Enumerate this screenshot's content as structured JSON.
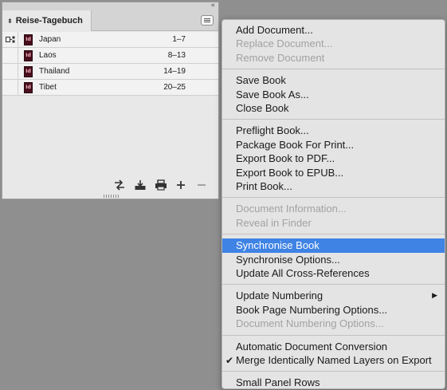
{
  "panel": {
    "title": "Reise-Tagebuch",
    "tab_arrows": "⬍",
    "collapse_glyph": "«",
    "documents": [
      {
        "name": "Japan",
        "pages": "1–7",
        "status": "synced-source"
      },
      {
        "name": "Laos",
        "pages": "8–13"
      },
      {
        "name": "Thailand",
        "pages": "14–19"
      },
      {
        "name": "Tibet",
        "pages": "20–25"
      }
    ],
    "doc_icon_text": "Id",
    "toolbar": [
      "sync-styles-icon",
      "save-book-icon",
      "print-book-icon",
      "add-document-icon",
      "remove-document-icon"
    ]
  },
  "menu": {
    "highlight_color": "#3f83e5",
    "groups": [
      [
        {
          "label": "Add Document...",
          "enabled": true
        },
        {
          "label": "Replace Document...",
          "enabled": false
        },
        {
          "label": "Remove Document",
          "enabled": false
        }
      ],
      [
        {
          "label": "Save Book",
          "enabled": true
        },
        {
          "label": "Save Book As...",
          "enabled": true
        },
        {
          "label": "Close Book",
          "enabled": true
        }
      ],
      [
        {
          "label": "Preflight Book...",
          "enabled": true
        },
        {
          "label": "Package Book For Print...",
          "enabled": true
        },
        {
          "label": "Export Book to PDF...",
          "enabled": true
        },
        {
          "label": "Export Book to EPUB...",
          "enabled": true
        },
        {
          "label": "Print Book...",
          "enabled": true
        }
      ],
      [
        {
          "label": "Document Information...",
          "enabled": false
        },
        {
          "label": "Reveal in Finder",
          "enabled": false
        }
      ],
      [
        {
          "label": "Synchronise Book",
          "enabled": true,
          "selected": true
        },
        {
          "label": "Synchronise Options...",
          "enabled": true
        },
        {
          "label": "Update All Cross-References",
          "enabled": true
        }
      ],
      [
        {
          "label": "Update Numbering",
          "enabled": true,
          "submenu": true
        },
        {
          "label": "Book Page Numbering Options...",
          "enabled": true
        },
        {
          "label": "Document Numbering Options...",
          "enabled": false
        }
      ],
      [
        {
          "label": "Automatic Document Conversion",
          "enabled": true
        },
        {
          "label": "Merge Identically Named Layers on Export",
          "enabled": true,
          "checked": true
        }
      ],
      [
        {
          "label": "Small Panel Rows",
          "enabled": true
        }
      ]
    ],
    "check_glyph": "✔",
    "submenu_glyph": "▶"
  }
}
